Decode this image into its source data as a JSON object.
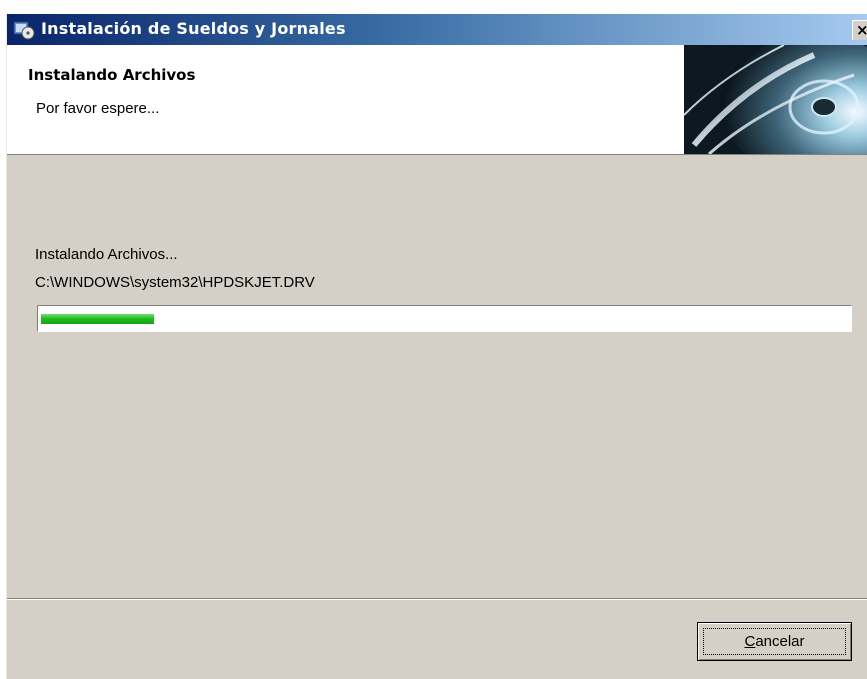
{
  "window": {
    "title": "Instalación de Sueldos y Jornales",
    "title_bar_color_start": "#0a246a",
    "title_bar_color_end": "#a6caf0",
    "close_icon": "close-icon"
  },
  "header": {
    "title": "Instalando Archivos",
    "subtitle": "Por favor espere...",
    "graphic_icon": "cd-disc-icon"
  },
  "body": {
    "status_label": "Instalando Archivos...",
    "current_file": "C:\\WINDOWS\\system32\\HPDSKJET.DRV",
    "progress_fraction": 0.14,
    "progress_color": "#1fb81f"
  },
  "footer": {
    "cancel_label": "Cancelar"
  }
}
